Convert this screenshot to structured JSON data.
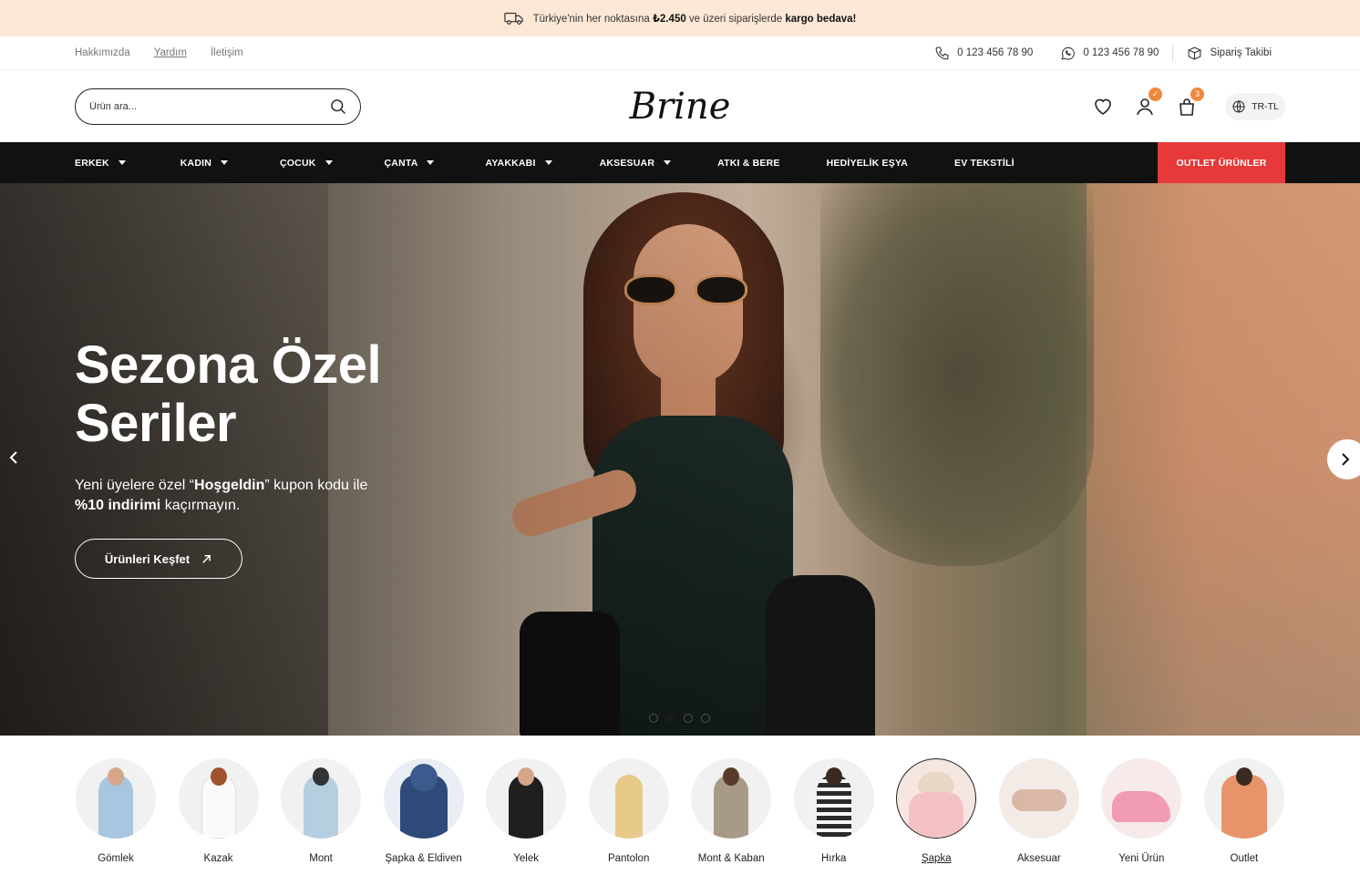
{
  "announcement": {
    "prefix": "Türkiye'nin her noktasına ",
    "amount": "₺2.450",
    "middle": " ve üzeri siparişlerde ",
    "highlight": "kargo bedava!"
  },
  "utility": {
    "links": [
      "Hakkımızda",
      "Yardım",
      "İletişim"
    ],
    "phone": "0 123 456 78 90",
    "whatsapp": "0 123 456 78 90",
    "order_tracking": "Sipariş Takibi"
  },
  "header": {
    "search_placeholder": "Ürün ara...",
    "logo": "Brine",
    "user_badge": "✓",
    "cart_badge": "3",
    "language": "TR-TL"
  },
  "nav": {
    "items": [
      "ERKEK",
      "KADIN",
      "ÇOCUK",
      "ÇANTA",
      "AYAKKABI",
      "AKSESUAR",
      "ATKI & BERE",
      "HEDİYELİK EŞYA",
      "EV TEKSTİLİ"
    ],
    "outlet": "OUTLET ÜRÜNLER"
  },
  "hero": {
    "title": "Sezona Özel Seriler",
    "sub_1": "Yeni üyelere özel “",
    "sub_code": "Hoşgeldin",
    "sub_2": "” kupon kodu ile",
    "sub_discount": "%10 indirimi",
    "sub_3": " kaçırmayın.",
    "button": "Ürünleri Keşfet",
    "slides": 4,
    "active_slide": 2
  },
  "categories": [
    {
      "label": "Gömlek",
      "color": "#a9c6e0"
    },
    {
      "label": "Kazak",
      "color": "#f4f4f4"
    },
    {
      "label": "Mont",
      "color": "#b6cfe0"
    },
    {
      "label": "Şapka & Eldiven",
      "color": "#2f4a78"
    },
    {
      "label": "Yelek",
      "color": "#1f1f1f"
    },
    {
      "label": "Pantolon",
      "color": "#e7c98a"
    },
    {
      "label": "Mont & Kaban",
      "color": "#a89a88"
    },
    {
      "label": "Hırka",
      "color": "#2a2a2a"
    },
    {
      "label": "Şapka",
      "color": "#f4c2c4"
    },
    {
      "label": "Aksesuar",
      "color": "#d9b8a8"
    },
    {
      "label": "Yeni Ürün",
      "color": "#f29bb5"
    },
    {
      "label": "Outlet",
      "color": "#e8946a"
    }
  ],
  "colors": {
    "accent_orange": "#f0883b",
    "outlet_red": "#e5393a",
    "nav_black": "#111111",
    "announce_bg": "#fde8d6"
  }
}
